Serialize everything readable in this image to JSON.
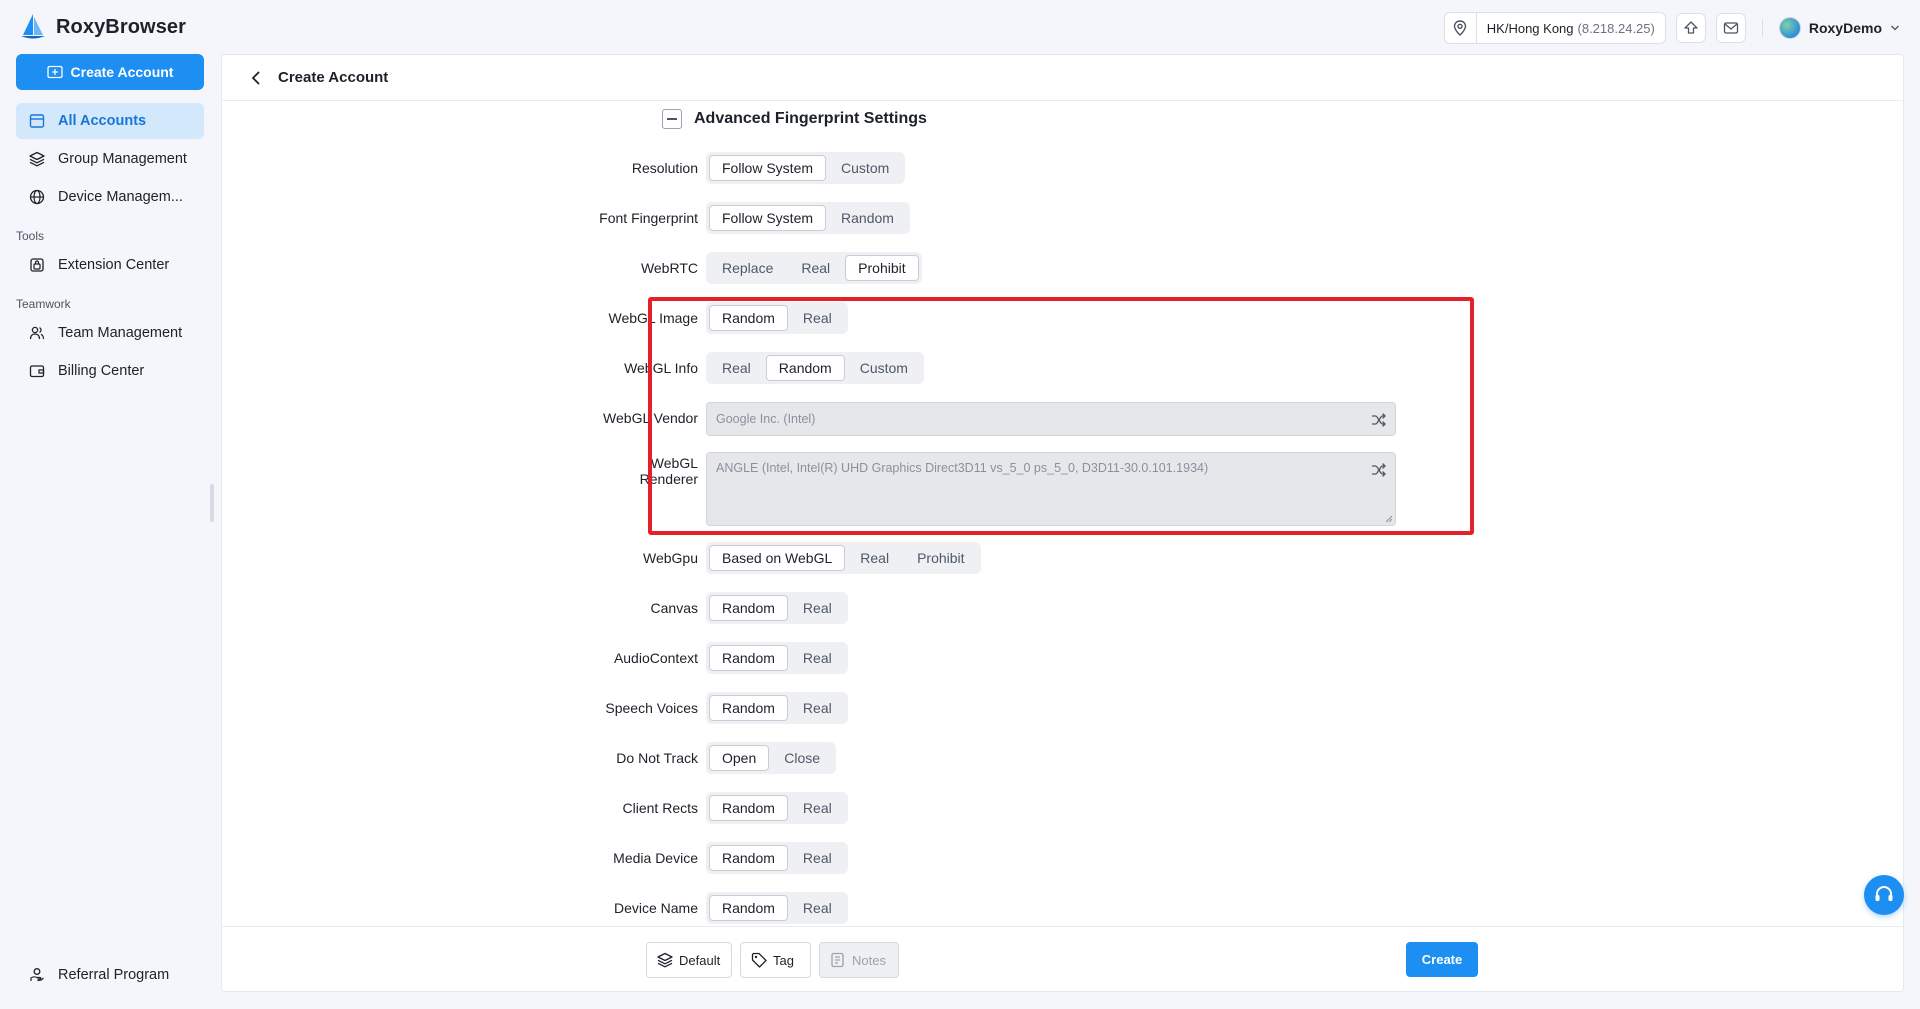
{
  "app": {
    "name": "RoxyBrowser"
  },
  "topbar": {
    "location": "HK/Hong Kong",
    "ip": "(8.218.24.25)",
    "user_name": "RoxyDemo"
  },
  "sidebar": {
    "create_label": "Create Account",
    "items": [
      {
        "label": "All Accounts"
      },
      {
        "label": "Group Management"
      },
      {
        "label": "Device Managem..."
      }
    ],
    "tools_heading": "Tools",
    "tools_items": [
      {
        "label": "Extension Center"
      }
    ],
    "teamwork_heading": "Teamwork",
    "teamwork_items": [
      {
        "label": "Team Management"
      },
      {
        "label": "Billing Center"
      }
    ],
    "referral_label": "Referral Program"
  },
  "page": {
    "title": "Create Account",
    "section_title": "Advanced Fingerprint Settings"
  },
  "settings": {
    "resolution": {
      "label": "Resolution",
      "options": [
        "Follow System",
        "Custom"
      ],
      "selected": "Follow System"
    },
    "font": {
      "label": "Font Fingerprint",
      "options": [
        "Follow System",
        "Random"
      ],
      "selected": "Follow System"
    },
    "webrtc": {
      "label": "WebRTC",
      "options": [
        "Replace",
        "Real",
        "Prohibit"
      ],
      "selected": "Prohibit"
    },
    "webgl_image": {
      "label": "WebGL Image",
      "options": [
        "Random",
        "Real"
      ],
      "selected": "Random"
    },
    "webgl_info": {
      "label": "WebGL Info",
      "options": [
        "Real",
        "Random",
        "Custom"
      ],
      "selected": "Random"
    },
    "webgl_vendor": {
      "label": "WebGL Vendor",
      "value": "Google Inc. (Intel)"
    },
    "webgl_renderer": {
      "label_line1": "WebGL",
      "label_line2": "Renderer",
      "value": "ANGLE (Intel, Intel(R) UHD Graphics Direct3D11 vs_5_0 ps_5_0, D3D11-30.0.101.1934)"
    },
    "webgpu": {
      "label": "WebGpu",
      "options": [
        "Based on WebGL",
        "Real",
        "Prohibit"
      ],
      "selected": "Based on WebGL"
    },
    "canvas": {
      "label": "Canvas",
      "options": [
        "Random",
        "Real"
      ],
      "selected": "Random"
    },
    "audio": {
      "label": "AudioContext",
      "options": [
        "Random",
        "Real"
      ],
      "selected": "Random"
    },
    "speech": {
      "label": "Speech Voices",
      "options": [
        "Random",
        "Real"
      ],
      "selected": "Random"
    },
    "dnt": {
      "label": "Do Not Track",
      "options": [
        "Open",
        "Close"
      ],
      "selected": "Open"
    },
    "client_rects": {
      "label": "Client Rects",
      "options": [
        "Random",
        "Real"
      ],
      "selected": "Random"
    },
    "media_device": {
      "label": "Media Device",
      "options": [
        "Random",
        "Real"
      ],
      "selected": "Random"
    },
    "device_name": {
      "label": "Device Name",
      "options": [
        "Random",
        "Real"
      ],
      "selected": "Random"
    }
  },
  "footer": {
    "default_label": "Default",
    "tag_label": "Tag",
    "notes_label": "Notes",
    "create_label": "Create"
  },
  "colors": {
    "accent": "#1d8ff3",
    "highlight": "#e4202a",
    "active_bg": "#d3e8fb"
  }
}
